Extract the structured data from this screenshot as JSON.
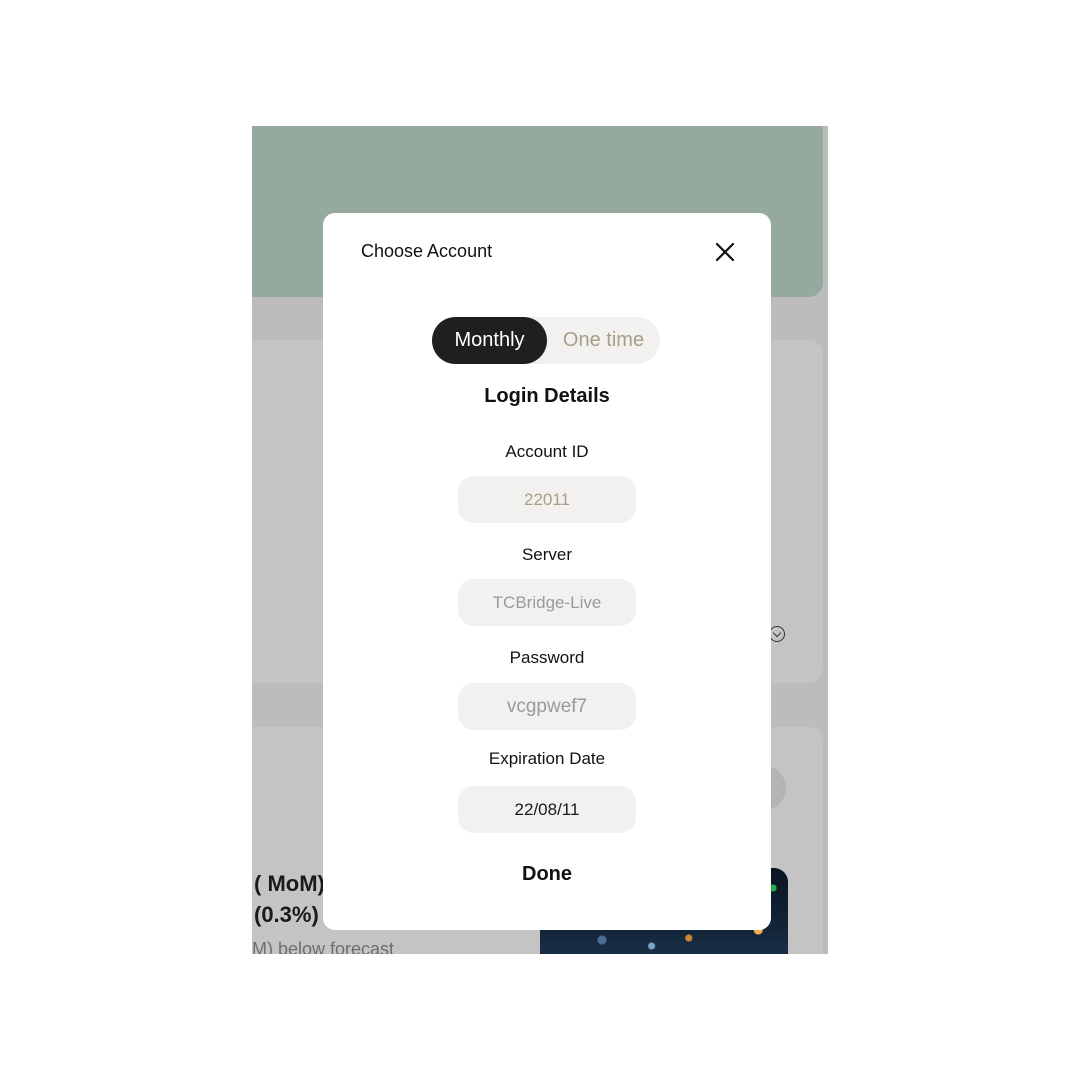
{
  "background": {
    "headline": "( MoM)\n(0.3%)",
    "subline": "M) below forecast"
  },
  "modal": {
    "title": "Choose Account",
    "segments": {
      "monthly": "Monthly",
      "one_time": "One time",
      "selected": "Monthly"
    },
    "section_title": "Login Details",
    "fields": {
      "account_id": {
        "label": "Account ID",
        "value": "22011"
      },
      "server": {
        "label": "Server",
        "value": "TCBridge-Live"
      },
      "password": {
        "label": "Password",
        "value": "vcgpwef7"
      },
      "expiration": {
        "label": "Expiration Date",
        "value": "22/08/11"
      }
    },
    "done_label": "Done"
  },
  "colors": {
    "hero_green": "#95aa9c",
    "overlay_gray": "#bcbcbc",
    "segment_active": "#1f1f1f",
    "segment_inactive_text": "#a59f86",
    "field_bg": "#f3f1ef"
  },
  "icons": {
    "close": "close-icon",
    "chevron": "chevron-down-circle-icon"
  }
}
